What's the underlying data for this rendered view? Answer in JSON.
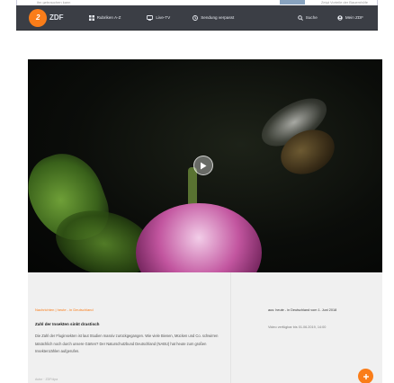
{
  "top_strip": {
    "fragment_left": "ihn gebrauchen kann",
    "fragment_right": "Zeigt Vorteile der Bauernhöfe"
  },
  "navbar": {
    "logo_text": "ZDF",
    "items": [
      {
        "label": "Rubriken A-Z",
        "icon": "grid-icon"
      },
      {
        "label": "Live-TV",
        "icon": "tv-icon"
      },
      {
        "label": "Sendung verpasst",
        "icon": "clock-icon"
      }
    ],
    "search_label": "Suche",
    "account_label": "Mein ZDF"
  },
  "content": {
    "breadcrumb": "Nachrichten | heute - in Deutschland",
    "headline": "Zahl der Insekten sinkt drastisch",
    "description": "Die Zahl der Fluginsekten ist laut Studien massiv zurückgegangen. Wie viele Bienen, Mücken und Co. schwirren tatsächlich noch durch unsere Gärten? Der Naturschutzbund Deutschland (NABU) hat heute zum großen Insektenzählen aufgerufen.",
    "date_label": "aus: heute - in Deutschland vom 1. Juni 2018",
    "availability": "Video verfügbar bis 01.06.2019, 14:00",
    "bottom_fragment": "Autor ·  ZDF/dpa"
  },
  "colors": {
    "accent": "#fa7d19",
    "navbar_bg": "#3b3e45",
    "content_bg": "#f0f0f0"
  }
}
